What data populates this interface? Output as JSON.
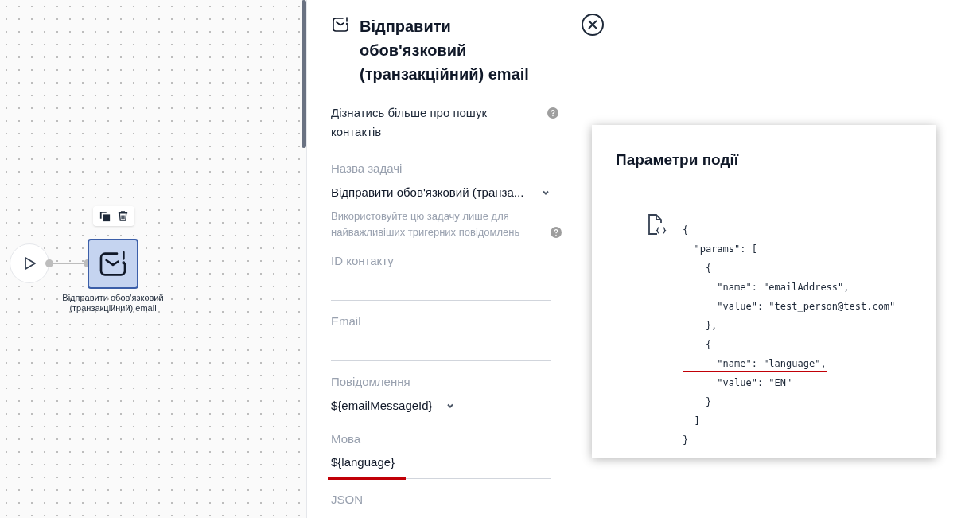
{
  "canvas": {
    "node": {
      "label": "Відправити обов'язковий (транзакційний) email",
      "selected": true
    }
  },
  "panel": {
    "title": "Відправити обов'язковий (транзакційний) email",
    "help_link": "Дізнатись більше про пошук контактів",
    "fields": [
      {
        "kind": "select",
        "label": "Назва задачі",
        "value": "Відправити обов'язковий (транза...",
        "hint": "Використовуйте цю задачу лише для найважливіших тригерних повідомлень",
        "highlighted": false
      },
      {
        "kind": "text",
        "label": "ID контакту",
        "highlighted": false
      },
      {
        "kind": "text",
        "label": "Email",
        "highlighted": false
      },
      {
        "kind": "select",
        "label": "Повідомлення",
        "value": "${emailMessageId}",
        "highlighted": false
      },
      {
        "kind": "text",
        "label": "Мова",
        "value": "${language}",
        "highlighted": true
      },
      {
        "kind": "label",
        "label": "JSON"
      }
    ]
  },
  "popup": {
    "title": "Параметри події",
    "code": [
      {
        "text": "{",
        "highlighted": false
      },
      {
        "text": "  \"params\": [",
        "highlighted": false
      },
      {
        "text": "    {",
        "highlighted": false
      },
      {
        "text": "      \"name\": \"emailAddress\",",
        "highlighted": false
      },
      {
        "text": "      \"value\": \"test_person@test.com\"",
        "highlighted": false
      },
      {
        "text": "    },",
        "highlighted": false
      },
      {
        "text": "    {",
        "highlighted": false
      },
      {
        "text": "      \"name\": \"language\",",
        "highlighted": true
      },
      {
        "text": "      \"value\": \"EN\"",
        "highlighted": false
      },
      {
        "text": "    }",
        "highlighted": false
      },
      {
        "text": "  ]",
        "highlighted": false
      },
      {
        "text": "}",
        "highlighted": false
      }
    ]
  }
}
